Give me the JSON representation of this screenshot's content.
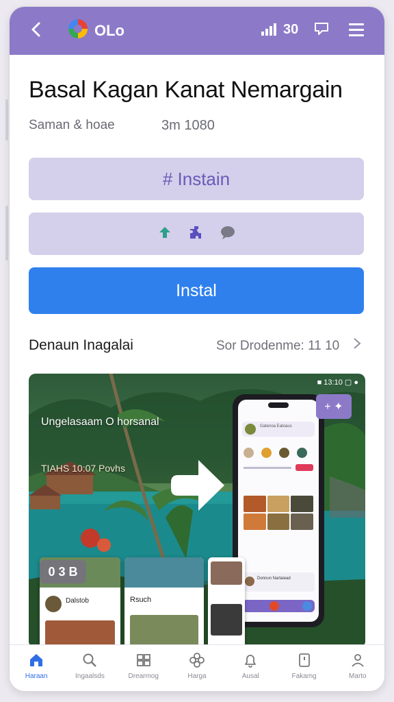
{
  "topbar": {
    "app_name": "OLo",
    "signal_text": "30",
    "back_icon": "back-icon",
    "logo_icon": "app-logo-icon",
    "chat_icon": "chat-icon",
    "menu_icon": "menu-icon"
  },
  "app": {
    "title": "Basal Kagan Kanat Nemargain",
    "meta_left": "Saman & hoae",
    "meta_right": "3m 1080"
  },
  "actions": {
    "tag_label": "# Instain",
    "icons": [
      "arrow-up-icon",
      "puzzle-icon",
      "comment-icon"
    ],
    "install_label": "Instal"
  },
  "section": {
    "left_label": "Denaun Inagalai",
    "right_label": "Sor Drodenme:  11 10",
    "chevron_icon": "chevron-right-icon"
  },
  "hero": {
    "status": "■ 13:10 ▢ ●",
    "caption_1": "Ungelasaam O horsanal",
    "caption_2": "TIAHS 10:07 Povhs",
    "badge": "0 3 B",
    "corner_badge": "+ ✦",
    "phone_header": "Gatenoa Eatoaus",
    "phone_card": "Donnun Nartaiead",
    "mini_card_1": "Dalstob",
    "mini_card_2": "Rsuch"
  },
  "bottom_nav": [
    {
      "label": "Haraan",
      "icon": "home-icon",
      "active": true
    },
    {
      "label": "Ingaalsds",
      "icon": "search-icon",
      "active": false
    },
    {
      "label": "Drearmog",
      "icon": "library-icon",
      "active": false
    },
    {
      "label": "Harga",
      "icon": "flower-icon",
      "active": false
    },
    {
      "label": "Ausal",
      "icon": "bell-icon",
      "active": false
    },
    {
      "label": "Fakamg",
      "icon": "bookmark-icon",
      "active": false
    },
    {
      "label": "Marto",
      "icon": "profile-icon",
      "active": false
    }
  ],
  "colors": {
    "accent": "#8c7ac8",
    "install_blue": "#2f80ed",
    "pill_bg": "#d4cfea"
  }
}
